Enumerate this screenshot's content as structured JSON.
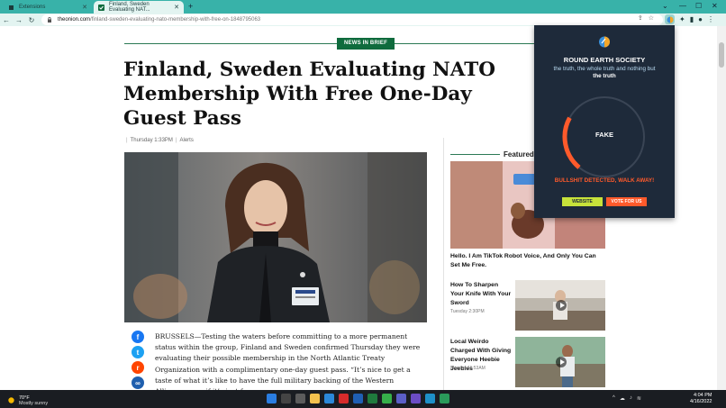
{
  "browser": {
    "tabs": [
      {
        "label": "Extensions"
      },
      {
        "label": "Finland, Sweden Evaluating NAT..."
      }
    ],
    "new_tab": "+",
    "url_host": "theonion.com",
    "url_path": "/finland-sweden-evaluating-nato-membership-with-free-on-1848795063",
    "nav": {
      "back": "←",
      "forward": "→",
      "reload": "↻"
    }
  },
  "article": {
    "section_badge": "NEWS IN BRIEF",
    "headline": "Finland, Sweden Evaluating NATO Membership With Free One-Day Guest Pass",
    "date": "Thursday 1:33PM",
    "category": "Alerts",
    "body": "BRUSSELS—Testing the waters before committing to a more permanent status within the group, Finland and Sweden confirmed Thursday they were evaluating their possible membership in the North Atlantic Treaty Organization with a complimentary one-day guest pass. “It’s nice to get a taste of what it’s like to have the full military backing of the Western Alliance, even if it’s just for a"
  },
  "sidebar": {
    "featured_label": "Featured V",
    "featured_title": "Hello. I Am TikTok Robot Voice, And Only You Can Set Me Free.",
    "cards": [
      {
        "title": "How To Sharpen Your Knife With Your Sword",
        "date": "Tuesday 2:30PM"
      },
      {
        "title": "Local Weirdo Charged With Giving Everyone Heebie Jeebies",
        "date": "Monday 11:53AM"
      }
    ]
  },
  "extension": {
    "title": "ROUND EARTH SOCIETY",
    "subtitle": "the truth, the whole truth and nothing but",
    "subtitle_bold": "the truth",
    "gauge_label": "FAKE",
    "gauge_level": 0.22,
    "verdict": "BULLSHIT DETECTED, WALK AWAY!",
    "website_btn": "WEBSITE",
    "vote_btn": "VOTE FOR US"
  },
  "taskbar": {
    "temp": "70°F",
    "weather": "Mostly sunny",
    "time": "4:04 PM",
    "date": "4/16/2022"
  },
  "colors": {
    "tabstrip": "#38b2a9",
    "onion_green": "#0f6b3d",
    "popup_bg": "#1e2a3a",
    "gauge_orange": "#ff5a2b",
    "website_btn": "#c7e23a"
  }
}
